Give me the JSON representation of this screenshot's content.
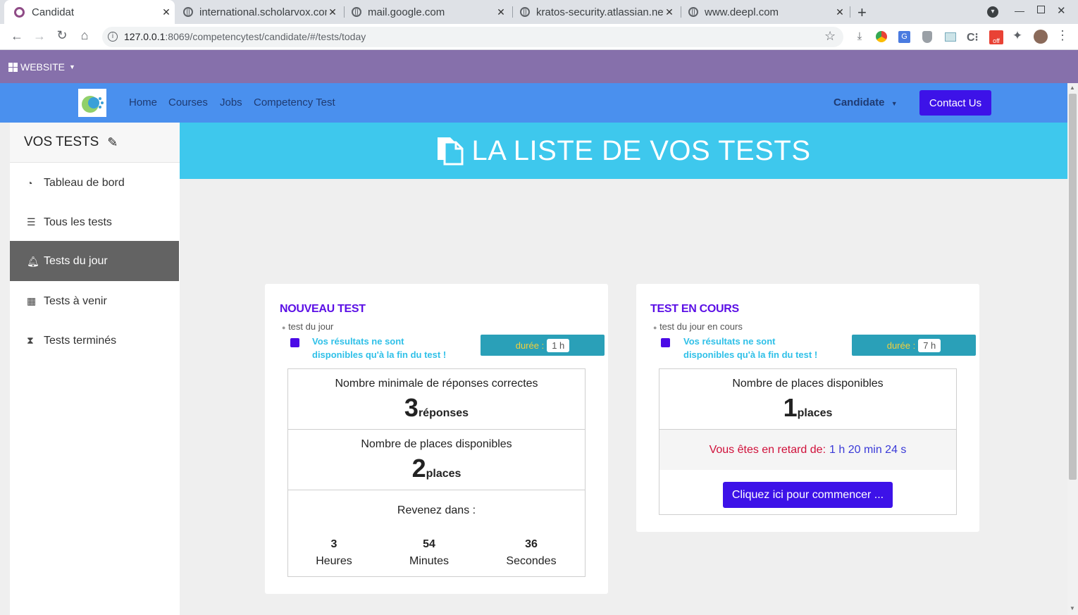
{
  "browser": {
    "tabs": [
      {
        "title": "Candidat"
      },
      {
        "title": "international.scholarvox.com"
      },
      {
        "title": "mail.google.com"
      },
      {
        "title": "kratos-security.atlassian.net"
      },
      {
        "title": "www.deepl.com"
      }
    ],
    "url_host": "127.0.0.1",
    "url_rest": ":8069/competencytest/candidate/#/tests/today"
  },
  "website_bar": {
    "label": "WEBSITE"
  },
  "nav": {
    "links": [
      "Home",
      "Courses",
      "Jobs",
      "Competency Test"
    ],
    "user_menu": "Candidate",
    "contact_label": "Contact Us"
  },
  "sidebar": {
    "title": "VOS TESTS",
    "items": [
      {
        "label": "Tableau de bord",
        "icon": "dashboard-icon"
      },
      {
        "label": "Tous les tests",
        "icon": "list-icon"
      },
      {
        "label": "Tests du jour",
        "icon": "bell-icon",
        "active": true
      },
      {
        "label": "Tests à venir",
        "icon": "calendar-icon"
      },
      {
        "label": "Tests terminés",
        "icon": "hourglass-icon"
      }
    ]
  },
  "banner": {
    "title": "LA LISTE DE VOS TESTS"
  },
  "card_new": {
    "title": "NOUVEAU TEST",
    "subtitle": "test du jour",
    "warning_line1": "Vos résultats ne sont",
    "warning_line2": "disponibles qu'à la fin du test !",
    "duration_label": "durée :",
    "duration_value": "1 h",
    "min_correct_label": "Nombre minimale de réponses correctes",
    "min_correct_value": "3",
    "min_correct_unit": "réponses",
    "places_label": "Nombre de places disponibles",
    "places_value": "2",
    "places_unit": "places",
    "countdown_label": "Revenez dans :",
    "countdown": [
      {
        "value": "3",
        "unit": "Heures"
      },
      {
        "value": "54",
        "unit": "Minutes"
      },
      {
        "value": "36",
        "unit": "Secondes"
      }
    ]
  },
  "card_current": {
    "title": "TEST EN COURS",
    "subtitle": "test du jour en cours",
    "warning_line1": "Vos résultats ne sont",
    "warning_line2": "disponibles qu'à la fin du test !",
    "duration_label": "durée :",
    "duration_value": "7 h",
    "places_label": "Nombre de places disponibles",
    "places_value": "1",
    "places_unit": "places",
    "late_label": "Vous êtes en retard de:",
    "late_value": "1 h 20 min 24 s",
    "start_button": "Cliquez ici pour commencer ..."
  },
  "colors": {
    "accent": "#4b0ae6",
    "navbar": "#4a90ee",
    "banner": "#3ec8ed",
    "website_bar": "#8670ab"
  }
}
